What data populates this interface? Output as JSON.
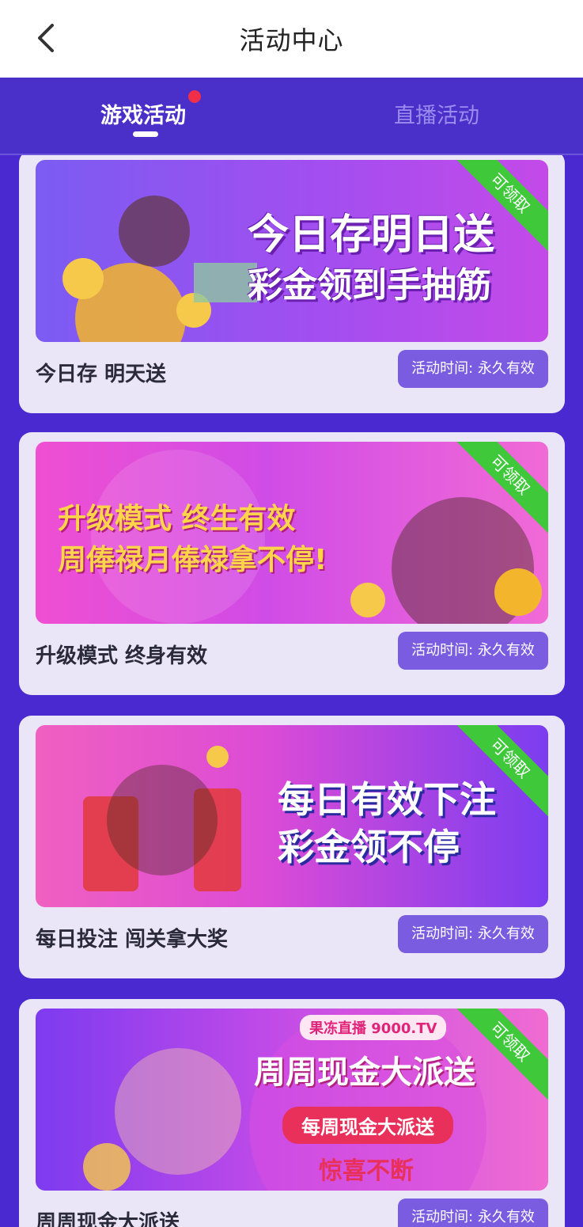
{
  "header": {
    "title": "活动中心"
  },
  "tabs": [
    {
      "label": "游戏活动"
    },
    {
      "label": "直播活动"
    }
  ],
  "cards": [
    {
      "name": "今日存 明天送",
      "time": "活动时间: 永久有效",
      "ribbon": "可领取",
      "banner_lines": [
        "今日存明日送",
        "彩金领到手抽筋"
      ]
    },
    {
      "name": "升级模式 终身有效",
      "time": "活动时间: 永久有效",
      "ribbon": "可领取",
      "banner_lines": [
        "升级模式 终生有效",
        "周俸禄月俸禄拿不停!"
      ]
    },
    {
      "name": "每日投注 闯关拿大奖",
      "time": "活动时间: 永久有效",
      "ribbon": "可领取",
      "banner_lines": [
        "每日有效下注",
        "彩金领不停"
      ]
    },
    {
      "name": "周周现金大派送",
      "time": "活动时间: 永久有效",
      "ribbon": "可领取",
      "banner_brand": "果冻直播 9000.TV",
      "banner_lines": [
        "周周现金大派送",
        "每周现金大派送",
        "惊喜不断"
      ]
    }
  ]
}
